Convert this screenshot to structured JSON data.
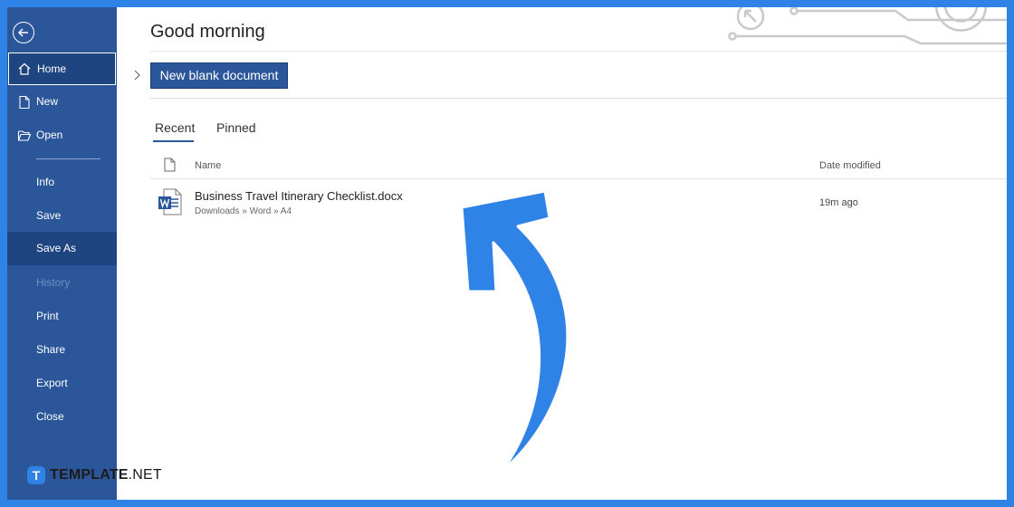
{
  "sidebar": {
    "items": [
      {
        "label": "Home"
      },
      {
        "label": "New"
      },
      {
        "label": "Open"
      },
      {
        "label": "Info"
      },
      {
        "label": "Save"
      },
      {
        "label": "Save As"
      },
      {
        "label": "History"
      },
      {
        "label": "Print"
      },
      {
        "label": "Share"
      },
      {
        "label": "Export"
      },
      {
        "label": "Close"
      }
    ]
  },
  "main": {
    "greeting": "Good morning",
    "new_blank_label": "New blank document",
    "tabs": [
      {
        "label": "Recent"
      },
      {
        "label": "Pinned"
      }
    ],
    "columns": {
      "name": "Name",
      "date": "Date modified"
    },
    "files": [
      {
        "name": "Business Travel Itinerary Checklist.docx",
        "path": "Downloads » Word » A4",
        "modified": "19m ago"
      }
    ]
  },
  "watermark": {
    "logo_letter": "T",
    "brand": "TEMPLATE",
    "suffix": ".NET"
  },
  "colors": {
    "sidebar": "#2b579a",
    "accent_arrow": "#2f82e6",
    "border": "#2f82e6"
  }
}
